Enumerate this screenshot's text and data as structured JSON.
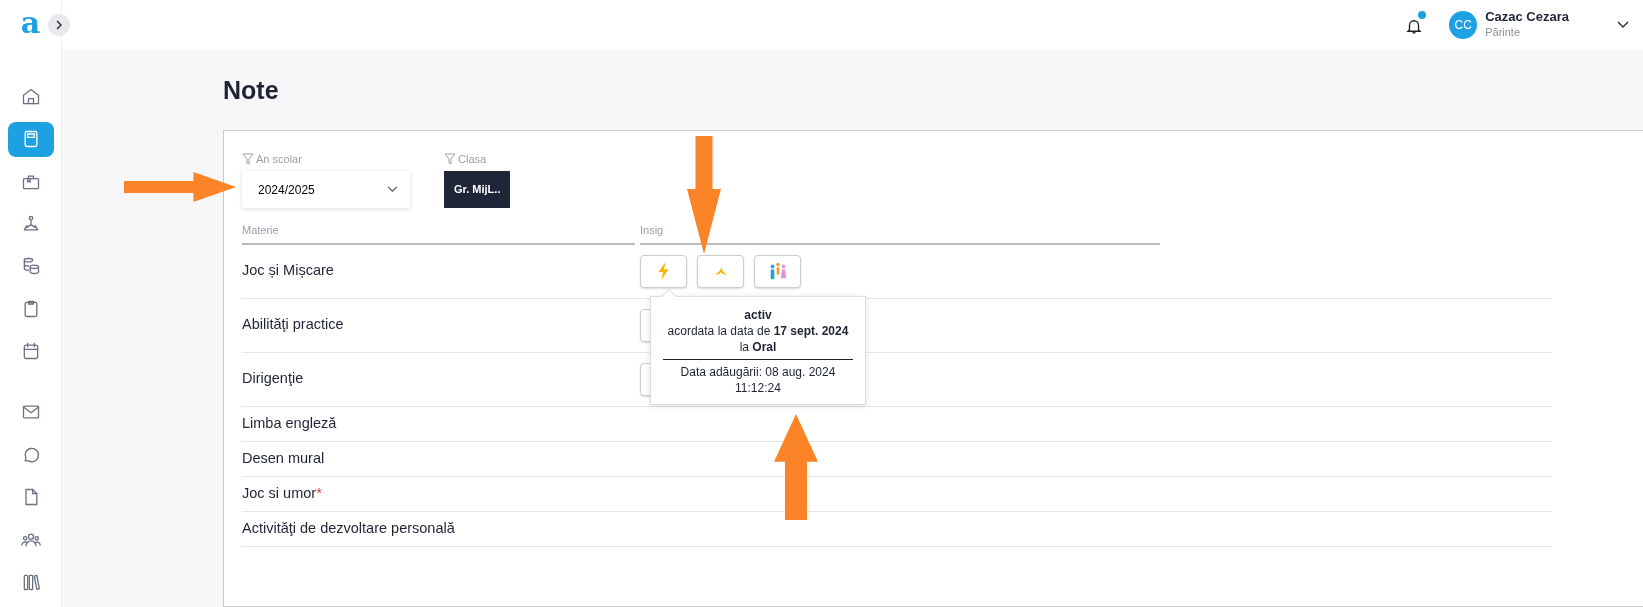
{
  "sidebar": {
    "logo": "a",
    "items": [
      {
        "kind": "home",
        "selected": false
      },
      {
        "kind": "notebook",
        "selected": true
      },
      {
        "kind": "briefcase",
        "selected": false
      },
      {
        "kind": "meditation",
        "selected": false
      },
      {
        "kind": "coins",
        "selected": false
      },
      {
        "kind": "clipboard",
        "selected": false
      },
      {
        "kind": "calendar",
        "selected": false
      },
      {
        "kind": "mail",
        "selected": false
      },
      {
        "kind": "chat",
        "selected": false
      },
      {
        "kind": "file",
        "selected": false
      },
      {
        "kind": "people",
        "selected": false
      },
      {
        "kind": "books",
        "selected": false
      }
    ]
  },
  "header": {
    "notifications": {
      "unread": true
    },
    "user": {
      "initials": "CC",
      "name": "Cazac Cezara",
      "role": "Părinte"
    }
  },
  "page_title": "Note",
  "filters": [
    {
      "kind": "select",
      "label": "An scolar",
      "value": "2024/2025"
    },
    {
      "kind": "button",
      "label": "Clasa",
      "value": "Gr. MijL.."
    }
  ],
  "table": {
    "columns": [
      "Materie",
      "Insig"
    ],
    "rows": [
      {
        "subject": "Joc și Mișcare",
        "insignia": [
          {
            "kind": "lightning",
            "tooltip": {
              "title": "activ",
              "line": "acordata la data de **17 sept. 2024**",
              "source": "la **Oral**",
              "added": "Data adăugării: 08 aug. 2024",
              "time": "11:12:24"
            }
          },
          {
            "kind": "banana"
          },
          {
            "kind": "people"
          }
        ]
      },
      {
        "subject": "Abilităţi practice",
        "insignia": [
          {
            "kind": "covered"
          }
        ]
      },
      {
        "subject": "Dirigenţie",
        "insignia": [
          {
            "kind": "covered"
          }
        ]
      },
      {
        "subject": "Limba engleză",
        "insignia": []
      },
      {
        "subject": "Desen mural",
        "insignia": []
      },
      {
        "subject": "Joc si umor",
        "required_mark": "*",
        "insignia": []
      },
      {
        "subject": "Activităţi de dezvoltare personală",
        "insignia": []
      }
    ]
  },
  "annotations": [
    {
      "kind": "arrow"
    },
    {
      "kind": "arrow"
    },
    {
      "kind": "arrow"
    }
  ]
}
